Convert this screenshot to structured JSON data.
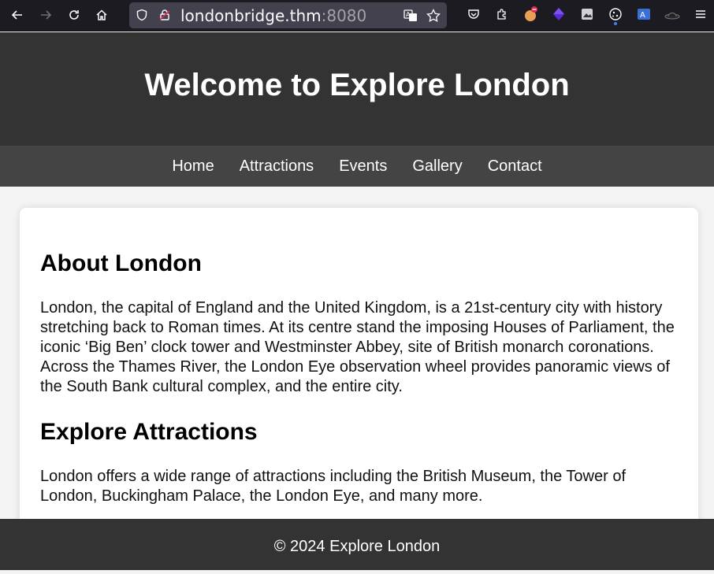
{
  "browser": {
    "url_host": "londonbridge.thm",
    "url_port": ":8080"
  },
  "page": {
    "title": "Welcome to Explore London",
    "nav": [
      "Home",
      "Attractions",
      "Events",
      "Gallery",
      "Contact"
    ],
    "sections": [
      {
        "heading": "About London",
        "body": "London, the capital of England and the United Kingdom, is a 21st-century city with history stretching back to Roman times. At its centre stand the imposing Houses of Parliament, the iconic ‘Big Ben’ clock tower and Westminster Abbey, site of British monarch coronations. Across the Thames River, the London Eye observation wheel provides panoramic views of the South Bank cultural complex, and the entire city."
      },
      {
        "heading": "Explore Attractions",
        "body": "London offers a wide range of attractions including the British Museum, the Tower of London, Buckingham Palace, the London Eye, and many more."
      }
    ],
    "footer": "© 2024 Explore London"
  }
}
